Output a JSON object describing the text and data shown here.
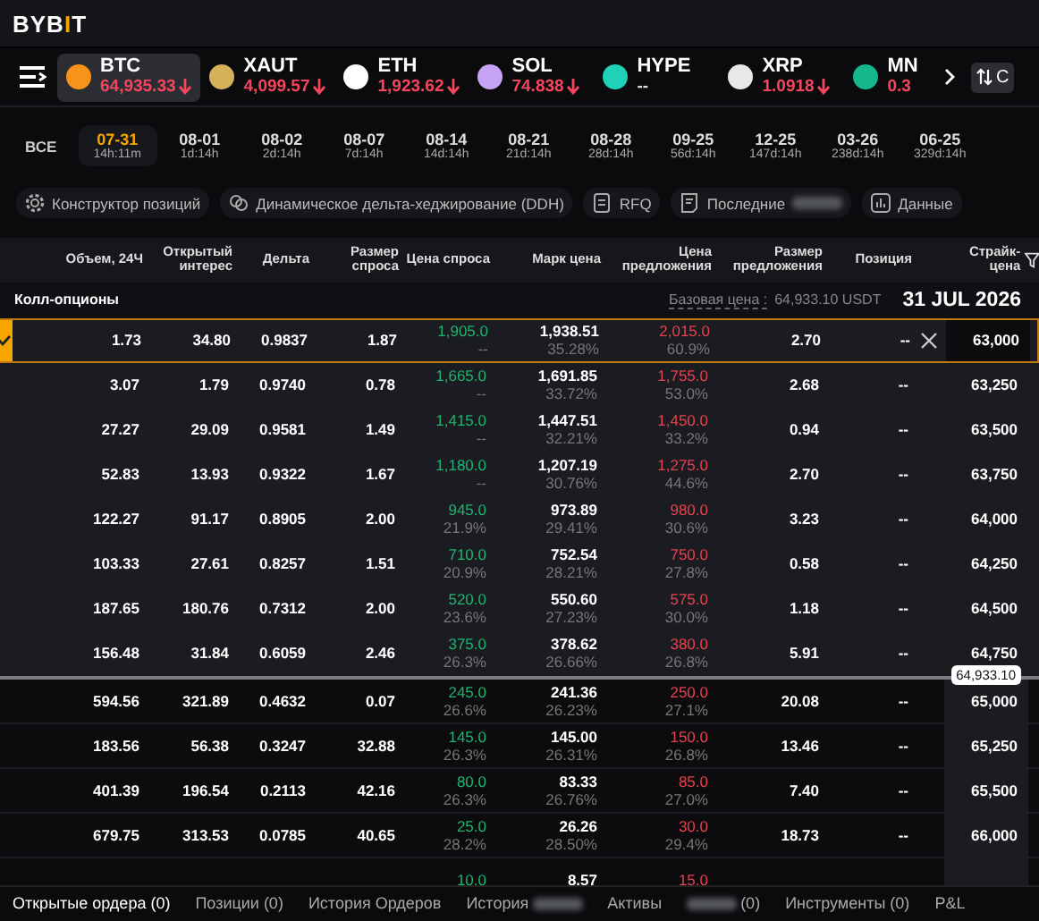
{
  "logo": [
    {
      "text": "BYB",
      "accent": false
    },
    {
      "text": "I",
      "accent": true
    },
    {
      "text": "T",
      "accent": false
    }
  ],
  "tickers": [
    {
      "symbol": "BTC",
      "price": "64,935.33",
      "falling": true,
      "arrow": true,
      "selected": true,
      "color": "#f7931a"
    },
    {
      "symbol": "XAUT",
      "price": "4,099.57",
      "falling": true,
      "arrow": true,
      "selected": false,
      "color": "#d4b25c"
    },
    {
      "symbol": "ETH",
      "price": "1,923.62",
      "falling": true,
      "arrow": true,
      "selected": false,
      "color": "#ffffff"
    },
    {
      "symbol": "SOL",
      "price": "74.838",
      "falling": true,
      "arrow": true,
      "selected": false,
      "color": "#c7a3f5"
    },
    {
      "symbol": "HYPE",
      "price": "--",
      "falling": false,
      "arrow": false,
      "selected": false,
      "color": "#1fd1b8"
    },
    {
      "symbol": "XRP",
      "price": "1.0918",
      "falling": true,
      "arrow": true,
      "selected": false,
      "color": "#e8e8e8"
    },
    {
      "symbol": "MN",
      "price": "0.3",
      "falling": true,
      "arrow": false,
      "selected": false,
      "color": "#14b88a"
    }
  ],
  "swap_button": {
    "label": "C"
  },
  "expiries": {
    "all_label": "ВСЕ",
    "items": [
      {
        "date": "07-31",
        "countdown": "14h:11m",
        "selected": true
      },
      {
        "date": "08-01",
        "countdown": "1d:14h",
        "selected": false
      },
      {
        "date": "08-02",
        "countdown": "2d:14h",
        "selected": false
      },
      {
        "date": "08-07",
        "countdown": "7d:14h",
        "selected": false
      },
      {
        "date": "08-14",
        "countdown": "14d:14h",
        "selected": false
      },
      {
        "date": "08-21",
        "countdown": "21d:14h",
        "selected": false
      },
      {
        "date": "08-28",
        "countdown": "28d:14h",
        "selected": false
      },
      {
        "date": "09-25",
        "countdown": "56d:14h",
        "selected": false
      },
      {
        "date": "12-25",
        "countdown": "147d:14h",
        "selected": false
      },
      {
        "date": "03-26",
        "countdown": "238d:14h",
        "selected": false
      },
      {
        "date": "06-25",
        "countdown": "329d:14h",
        "selected": false
      }
    ]
  },
  "tools": [
    {
      "label": "Конструктор позиций",
      "kind": "gear",
      "redacted": false
    },
    {
      "label": "Динамическое дельта-хеджирование (DDH)",
      "kind": "link",
      "redacted": false
    },
    {
      "label": "RFQ",
      "kind": "doc",
      "redacted": false
    },
    {
      "label": "Последние",
      "kind": "note",
      "redacted": true
    },
    {
      "label": "Данные",
      "kind": "chart",
      "redacted": false
    }
  ],
  "table": {
    "columns": [
      "Объем, 24Ч",
      "Открытый интерес",
      "Дельта",
      "Размер спроса",
      "Цена спроса",
      "Марк цена",
      "Цена предложения",
      "Размер предложения",
      "Позиция",
      "Страйк-цена"
    ],
    "section": {
      "title": "Колл-опционы",
      "base_label": "Базовая цена :",
      "base_value": "64,933.10 USDT",
      "expiry": "31 JUL 2026"
    },
    "price_tag": "64,933.10",
    "rows": [
      {
        "volume": "1.73",
        "oi": "34.80",
        "delta": "0.9837",
        "bid_size": "1.87",
        "bid": "1,905.0",
        "bid_sub": "--",
        "mark": "1,938.51",
        "mark_iv": "35.28%",
        "ask": "2,015.0",
        "ask_sub": "60.9%",
        "ask_size": "2.70",
        "position": "--",
        "strike": "63,000",
        "selected": true,
        "in_the_money": true,
        "price_line_above": false
      },
      {
        "volume": "3.07",
        "oi": "1.79",
        "delta": "0.9740",
        "bid_size": "0.78",
        "bid": "1,665.0",
        "bid_sub": "--",
        "mark": "1,691.85",
        "mark_iv": "33.72%",
        "ask": "1,755.0",
        "ask_sub": "53.0%",
        "ask_size": "2.68",
        "position": "--",
        "strike": "63,250",
        "selected": false,
        "in_the_money": true,
        "price_line_above": false
      },
      {
        "volume": "27.27",
        "oi": "29.09",
        "delta": "0.9581",
        "bid_size": "1.49",
        "bid": "1,415.0",
        "bid_sub": "--",
        "mark": "1,447.51",
        "mark_iv": "32.21%",
        "ask": "1,450.0",
        "ask_sub": "33.2%",
        "ask_size": "0.94",
        "position": "--",
        "strike": "63,500",
        "selected": false,
        "in_the_money": true,
        "price_line_above": false
      },
      {
        "volume": "52.83",
        "oi": "13.93",
        "delta": "0.9322",
        "bid_size": "1.67",
        "bid": "1,180.0",
        "bid_sub": "--",
        "mark": "1,207.19",
        "mark_iv": "30.76%",
        "ask": "1,275.0",
        "ask_sub": "44.6%",
        "ask_size": "2.70",
        "position": "--",
        "strike": "63,750",
        "selected": false,
        "in_the_money": true,
        "price_line_above": false
      },
      {
        "volume": "122.27",
        "oi": "91.17",
        "delta": "0.8905",
        "bid_size": "2.00",
        "bid": "945.0",
        "bid_sub": "21.9%",
        "mark": "973.89",
        "mark_iv": "29.41%",
        "ask": "980.0",
        "ask_sub": "30.6%",
        "ask_size": "3.23",
        "position": "--",
        "strike": "64,000",
        "selected": false,
        "in_the_money": true,
        "price_line_above": false
      },
      {
        "volume": "103.33",
        "oi": "27.61",
        "delta": "0.8257",
        "bid_size": "1.51",
        "bid": "710.0",
        "bid_sub": "20.9%",
        "mark": "752.54",
        "mark_iv": "28.21%",
        "ask": "750.0",
        "ask_sub": "27.8%",
        "ask_size": "0.58",
        "position": "--",
        "strike": "64,250",
        "selected": false,
        "in_the_money": true,
        "price_line_above": false
      },
      {
        "volume": "187.65",
        "oi": "180.76",
        "delta": "0.7312",
        "bid_size": "2.00",
        "bid": "520.0",
        "bid_sub": "23.6%",
        "mark": "550.60",
        "mark_iv": "27.23%",
        "ask": "575.0",
        "ask_sub": "30.0%",
        "ask_size": "1.18",
        "position": "--",
        "strike": "64,500",
        "selected": false,
        "in_the_money": true,
        "price_line_above": false
      },
      {
        "volume": "156.48",
        "oi": "31.84",
        "delta": "0.6059",
        "bid_size": "2.46",
        "bid": "375.0",
        "bid_sub": "26.3%",
        "mark": "378.62",
        "mark_iv": "26.66%",
        "ask": "380.0",
        "ask_sub": "26.8%",
        "ask_size": "5.91",
        "position": "--",
        "strike": "64,750",
        "selected": false,
        "in_the_money": true,
        "price_line_above": false
      },
      {
        "volume": "594.56",
        "oi": "321.89",
        "delta": "0.4632",
        "bid_size": "0.07",
        "bid": "245.0",
        "bid_sub": "26.6%",
        "mark": "241.36",
        "mark_iv": "26.23%",
        "ask": "250.0",
        "ask_sub": "27.1%",
        "ask_size": "20.08",
        "position": "--",
        "strike": "65,000",
        "selected": false,
        "in_the_money": false,
        "price_line_above": true
      },
      {
        "volume": "183.56",
        "oi": "56.38",
        "delta": "0.3247",
        "bid_size": "32.88",
        "bid": "145.0",
        "bid_sub": "26.3%",
        "mark": "145.00",
        "mark_iv": "26.31%",
        "ask": "150.0",
        "ask_sub": "26.8%",
        "ask_size": "13.46",
        "position": "--",
        "strike": "65,250",
        "selected": false,
        "in_the_money": false,
        "price_line_above": false
      },
      {
        "volume": "401.39",
        "oi": "196.54",
        "delta": "0.2113",
        "bid_size": "42.16",
        "bid": "80.0",
        "bid_sub": "26.3%",
        "mark": "83.33",
        "mark_iv": "26.76%",
        "ask": "85.0",
        "ask_sub": "27.0%",
        "ask_size": "7.40",
        "position": "--",
        "strike": "65,500",
        "selected": false,
        "in_the_money": false,
        "price_line_above": false
      },
      {
        "volume": "679.75",
        "oi": "313.53",
        "delta": "0.0785",
        "bid_size": "40.65",
        "bid": "25.0",
        "bid_sub": "28.2%",
        "mark": "26.26",
        "mark_iv": "28.50%",
        "ask": "30.0",
        "ask_sub": "29.4%",
        "ask_size": "18.73",
        "position": "--",
        "strike": "66,000",
        "selected": false,
        "in_the_money": false,
        "price_line_above": false
      },
      {
        "bid": "10.0",
        "mark": "8.57",
        "ask": "15.0",
        "selected": false,
        "in_the_money": false,
        "price_line_above": false
      }
    ]
  },
  "bottom_tabs": [
    {
      "label": "Открытые ордера (0)",
      "selected": true,
      "redacted_before": false,
      "redacted_after": false
    },
    {
      "label": "Позиции (0)",
      "selected": false,
      "redacted_before": false,
      "redacted_after": false
    },
    {
      "label": "История Ордеров",
      "selected": false,
      "redacted_before": false,
      "redacted_after": false
    },
    {
      "label": "История",
      "selected": false,
      "redacted_before": false,
      "redacted_after": true
    },
    {
      "label": "Активы",
      "selected": false,
      "redacted_before": false,
      "redacted_after": false
    },
    {
      "label": "(0)",
      "selected": false,
      "redacted_before": true,
      "redacted_after": false
    },
    {
      "label": "Инструменты (0)",
      "selected": false,
      "redacted_before": false,
      "redacted_after": false
    },
    {
      "label": "P&L",
      "selected": false,
      "redacted_before": false,
      "redacted_after": false
    }
  ]
}
